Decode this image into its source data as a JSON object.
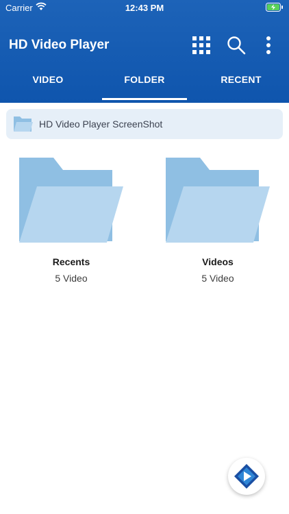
{
  "status_bar": {
    "carrier": "Carrier",
    "time": "12:43 PM",
    "wifi_icon": "wifi-icon",
    "battery_icon": "battery-charging-icon"
  },
  "app_bar": {
    "title": "HD Video Player",
    "icons": [
      "grid-view-icon",
      "search-icon",
      "more-vert-icon"
    ],
    "color": "#1d63b8"
  },
  "tabs": [
    {
      "label": "VIDEO",
      "selected": false
    },
    {
      "label": "FOLDER",
      "selected": true
    },
    {
      "label": "RECENT",
      "selected": false
    }
  ],
  "breadcrumb": {
    "label": "HD Video Player ScreenShot",
    "icon": "folder-icon",
    "background": "#e6eff8"
  },
  "folders": [
    {
      "name": "Recents",
      "count": "5 Video"
    },
    {
      "name": "Videos",
      "count": "5 Video"
    }
  ],
  "folder_colors": {
    "back": "#8fbfe3",
    "front": "#b6d6ef"
  },
  "fab": {
    "icon": "play-logo-icon"
  }
}
